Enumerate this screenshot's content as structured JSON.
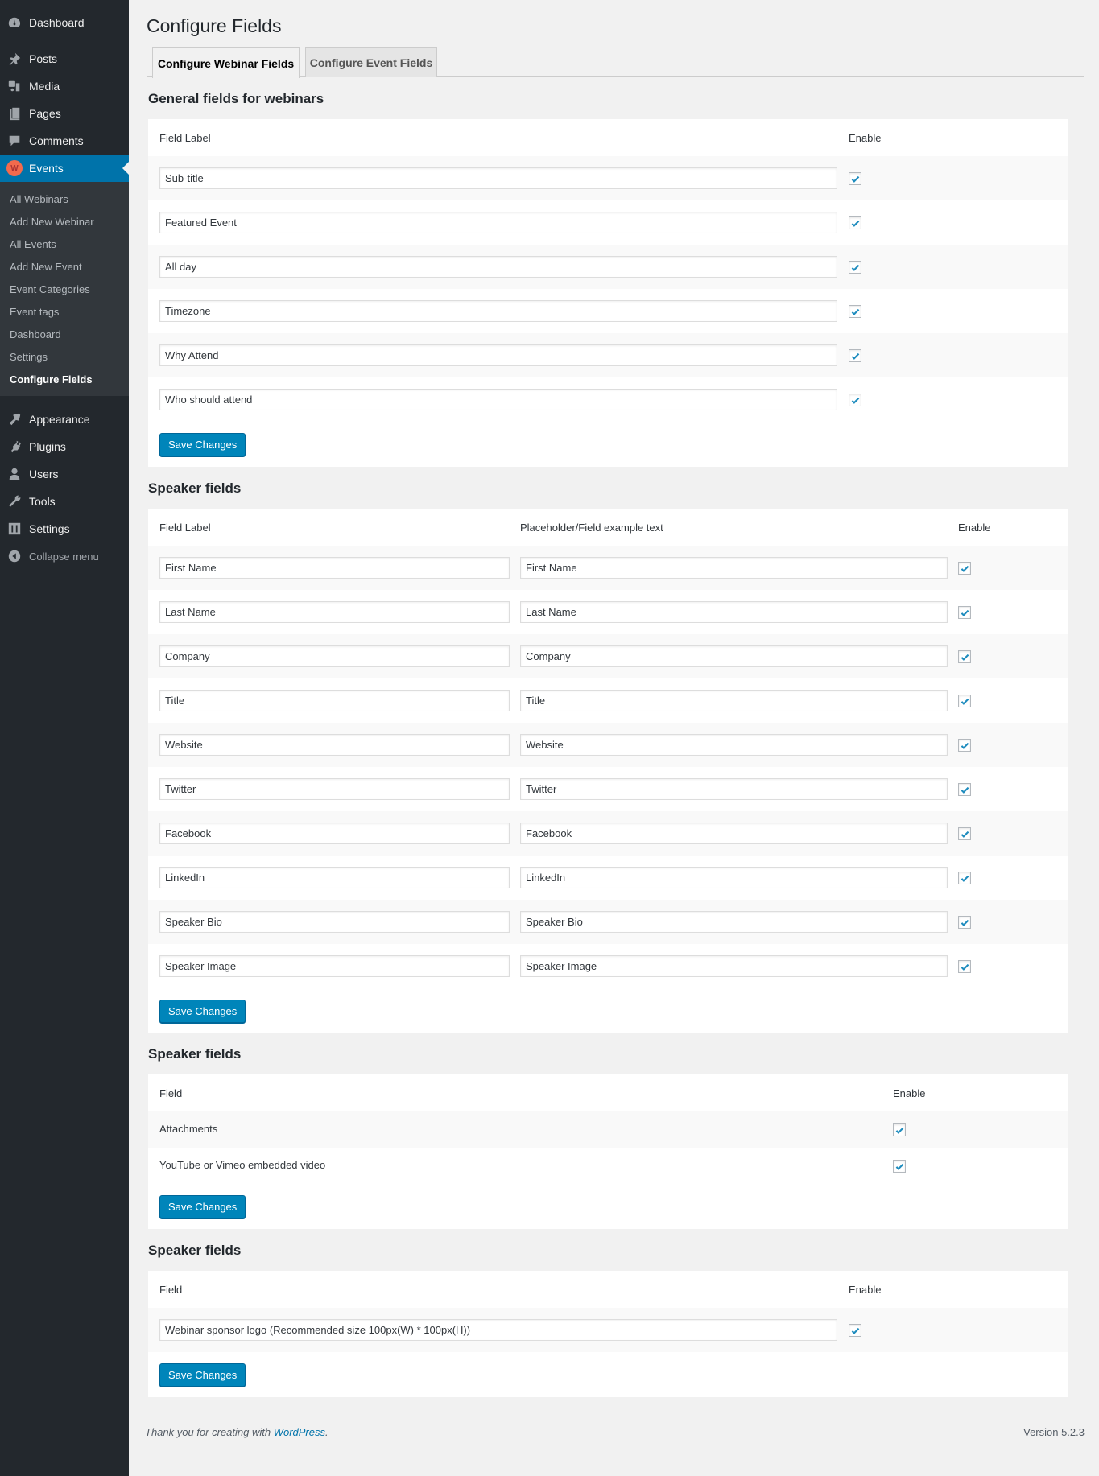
{
  "sidebar": {
    "top_items": [
      {
        "label": "Dashboard",
        "icon": "dashboard-icon"
      },
      {
        "label": "Posts",
        "icon": "pin-icon"
      },
      {
        "label": "Media",
        "icon": "media-icon"
      },
      {
        "label": "Pages",
        "icon": "pages-icon"
      },
      {
        "label": "Comments",
        "icon": "comment-icon"
      },
      {
        "label": "Events",
        "icon": "events-badge-icon",
        "badge": "W",
        "active": true
      }
    ],
    "submenu": [
      {
        "label": "All Webinars"
      },
      {
        "label": "Add New Webinar"
      },
      {
        "label": "All Events"
      },
      {
        "label": "Add New Event"
      },
      {
        "label": "Event Categories"
      },
      {
        "label": "Event tags"
      },
      {
        "label": "Dashboard"
      },
      {
        "label": "Settings"
      },
      {
        "label": "Configure Fields",
        "current": true
      }
    ],
    "bottom_items": [
      {
        "label": "Appearance",
        "icon": "paintbrush-icon"
      },
      {
        "label": "Plugins",
        "icon": "plug-icon"
      },
      {
        "label": "Users",
        "icon": "user-icon"
      },
      {
        "label": "Tools",
        "icon": "wrench-icon"
      },
      {
        "label": "Settings",
        "icon": "sliders-icon"
      },
      {
        "label": "Collapse menu",
        "icon": "collapse-icon"
      }
    ]
  },
  "page": {
    "title": "Configure Fields",
    "tabs": [
      {
        "label": "Configure Webinar Fields",
        "active": true
      },
      {
        "label": "Configure Event Fields",
        "active": false
      }
    ]
  },
  "general": {
    "title": "General fields for webinars",
    "headers": {
      "label": "Field Label",
      "enable": "Enable"
    },
    "rows": [
      {
        "value": "Sub-title",
        "enabled": true
      },
      {
        "value": "Featured Event",
        "enabled": true
      },
      {
        "value": "All day",
        "enabled": true
      },
      {
        "value": "Timezone",
        "enabled": true
      },
      {
        "value": "Why Attend",
        "enabled": true
      },
      {
        "value": "Who should attend",
        "enabled": true
      }
    ],
    "save_label": "Save Changes"
  },
  "speaker": {
    "title": "Speaker fields",
    "headers": {
      "label": "Field Label",
      "placeholder": "Placeholder/Field example text",
      "enable": "Enable"
    },
    "rows": [
      {
        "label": "First Name",
        "placeholder": "First Name",
        "enabled": true
      },
      {
        "label": "Last Name",
        "placeholder": "Last Name",
        "enabled": true
      },
      {
        "label": "Company",
        "placeholder": "Company",
        "enabled": true
      },
      {
        "label": "Title",
        "placeholder": "Title",
        "enabled": true
      },
      {
        "label": "Website",
        "placeholder": "Website",
        "enabled": true
      },
      {
        "label": "Twitter",
        "placeholder": "Twitter",
        "enabled": true
      },
      {
        "label": "Facebook",
        "placeholder": "Facebook",
        "enabled": true
      },
      {
        "label": "LinkedIn",
        "placeholder": "LinkedIn",
        "enabled": true
      },
      {
        "label": "Speaker Bio",
        "placeholder": "Speaker Bio",
        "enabled": true
      },
      {
        "label": "Speaker Image",
        "placeholder": "Speaker Image",
        "enabled": true
      }
    ],
    "save_label": "Save Changes"
  },
  "media": {
    "title": "Speaker fields",
    "headers": {
      "field": "Field",
      "enable": "Enable"
    },
    "rows": [
      {
        "label": "Attachments",
        "enabled": true
      },
      {
        "label": "YouTube or Vimeo embedded video",
        "enabled": true
      }
    ],
    "save_label": "Save Changes"
  },
  "sponsor": {
    "title": "Speaker fields",
    "headers": {
      "field": "Field",
      "enable": "Enable"
    },
    "rows": [
      {
        "value": "Webinar sponsor logo (Recommended size 100px(W) * 100px(H))",
        "enabled": true
      }
    ],
    "save_label": "Save Changes"
  },
  "footer": {
    "thanks_prefix": "Thank you for creating with ",
    "thanks_link": "WordPress",
    "thanks_suffix": ".",
    "version": "Version 5.2.3"
  },
  "colors": {
    "sidebar_bg": "#23282d",
    "submenu_bg": "#32373c",
    "accent": "#0073aa",
    "button": "#0085ba",
    "check": "#1e8cbe",
    "events_badge": "#f26a4d"
  }
}
